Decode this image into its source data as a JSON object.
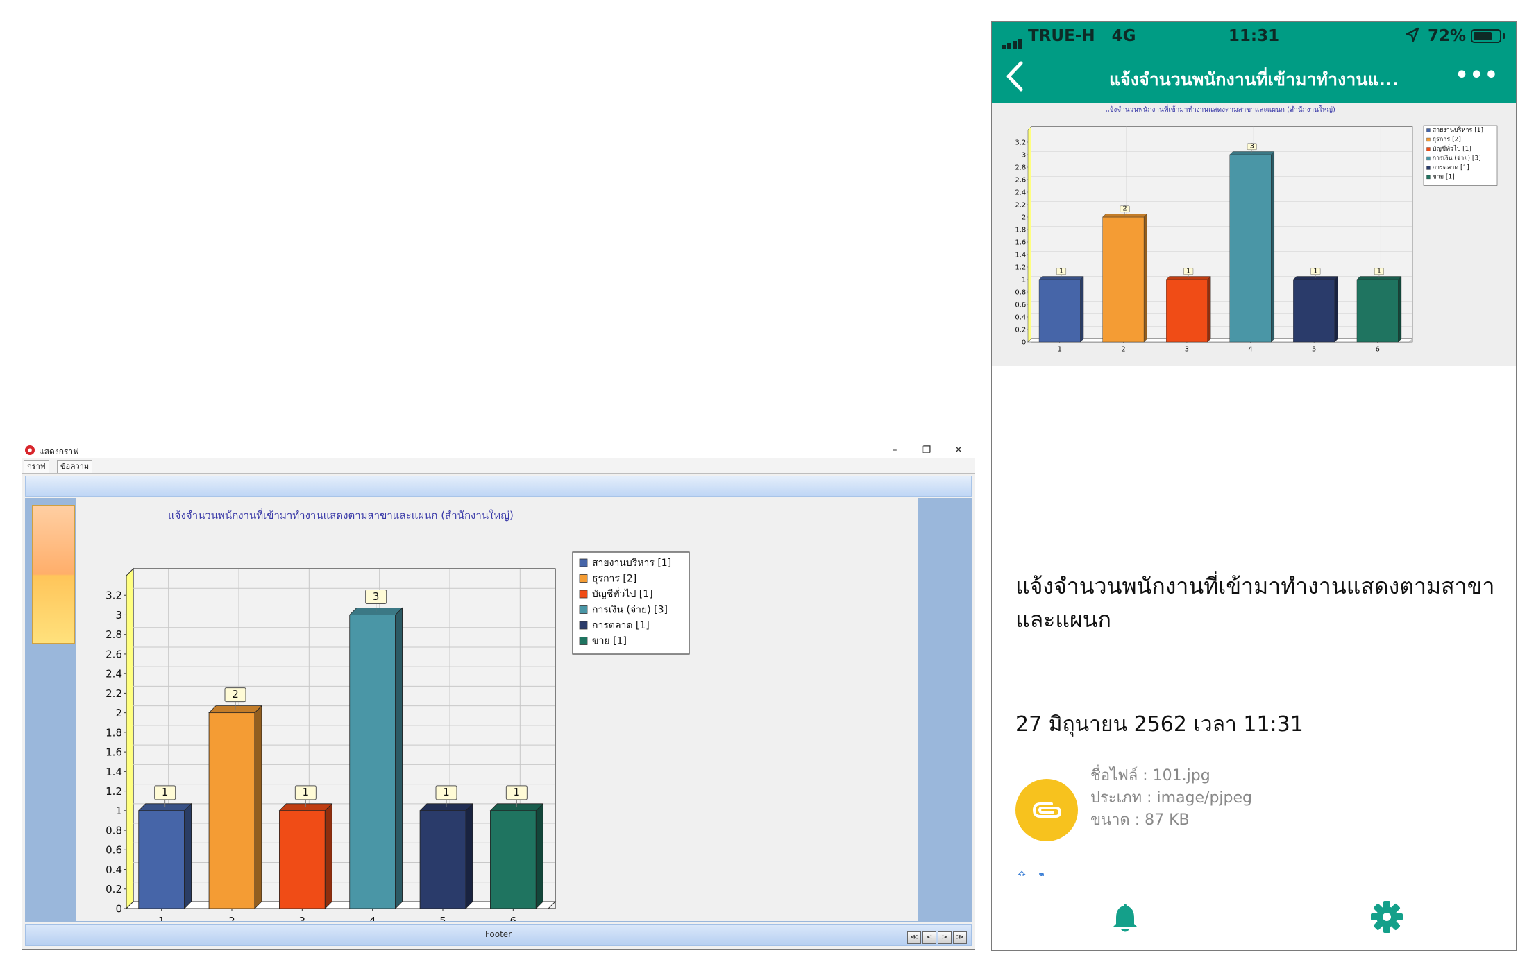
{
  "window": {
    "title": "แสดงกราฟ",
    "controls": {
      "minimize": "–",
      "restore": "❐",
      "close": "✕"
    },
    "tabs": [
      {
        "label": "กราฟ"
      },
      {
        "label": "ข้อความ"
      }
    ],
    "footer": "Footer",
    "nav_buttons": [
      "≪",
      "<",
      ">",
      "≫"
    ]
  },
  "phone": {
    "status": {
      "carrier": "TRUE-H",
      "network": "4G",
      "time": "11:31",
      "battery": "72%",
      "battery_level": 0.72
    },
    "nav_title": "แจ้งจำนวนพนักงานที่เข้ามาทำงานแ...",
    "message_title": "แจ้งจำนวนพนักงานที่เข้ามาทำงานแสดงตามสาขาและแผนก",
    "message_date": "27 มิถุนายน 2562 เวลา 11:31",
    "attachment": {
      "filename": "ชื่อไฟล์ : 101.jpg",
      "type": "ประเภท : image/pjpeg",
      "size": "ขนาด : 87 KB"
    },
    "partial_link": "⇧ ↗"
  },
  "chart_data": [
    {
      "type": "bar",
      "title": "แจ้งจำนวนพนักงานที่เข้ามาทำงานแสดงตามสาขาและแผนก (สำนักงานใหญ่)",
      "categories": [
        "1",
        "2",
        "3",
        "4",
        "5",
        "6"
      ],
      "values": [
        1,
        2,
        1,
        3,
        1,
        1
      ],
      "colors": [
        "#4665a8",
        "#f49c34",
        "#f04c16",
        "#4a96a6",
        "#2a3b6a",
        "#1f7460"
      ],
      "legend": [
        "สายงานบริหาร [1]",
        "ธุรการ [2]",
        "บัญชีทั่วไป [1]",
        "การเงิน (จ่าย) [3]",
        "การตลาด [1]",
        "ขาย [1]"
      ],
      "y_ticks": [
        "0",
        "0.2",
        "0.4",
        "0.6",
        "0.8",
        "1",
        "1.2",
        "1.4",
        "1.6",
        "1.8",
        "2",
        "2.2",
        "2.4",
        "2.6",
        "2.8",
        "3",
        "3.2"
      ],
      "ylim": [
        0,
        3.4
      ],
      "grid": true,
      "legend_position": "top-right",
      "data_labels": [
        "1",
        "2",
        "1",
        "3",
        "1",
        "1"
      ]
    },
    {
      "type": "bar",
      "title": "แจ้งจำนวนพนักงานที่เข้ามาทำงานแสดงตามสาขาและแผนก (สำนักงานใหญ่)",
      "categories": [
        "1",
        "2",
        "3",
        "4",
        "5",
        "6"
      ],
      "values": [
        1,
        2,
        1,
        3,
        1,
        1
      ],
      "colors": [
        "#4665a8",
        "#f49c34",
        "#f04c16",
        "#4a96a6",
        "#2a3b6a",
        "#1f7460"
      ],
      "legend": [
        "สายงานบริหาร [1]",
        "ธุรการ [2]",
        "บัญชีทั่วไป [1]",
        "การเงิน (จ่าย) [3]",
        "การตลาด [1]",
        "ขาย [1]"
      ],
      "y_ticks": [
        "0",
        "0.2",
        "0.4",
        "0.6",
        "0.8",
        "1",
        "1.2",
        "1.4",
        "1.6",
        "1.8",
        "2",
        "2.2",
        "2.4",
        "2.6",
        "2.8",
        "3",
        "3.2"
      ],
      "ylim": [
        0,
        3.4
      ],
      "grid": true,
      "legend_position": "top-right",
      "data_labels": [
        "1",
        "2",
        "1",
        "3",
        "1",
        "1"
      ]
    }
  ]
}
